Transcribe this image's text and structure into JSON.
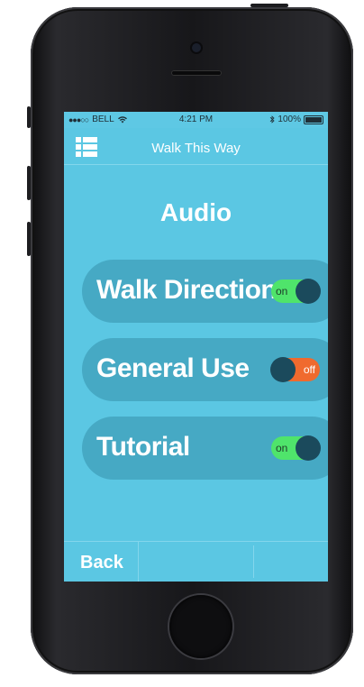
{
  "status_bar": {
    "signal": "●●●○○",
    "carrier": "BELL",
    "wifi_icon": "wifi-icon",
    "time": "4:21 PM",
    "bluetooth_icon": "bluetooth-icon",
    "battery": "100%"
  },
  "nav": {
    "title": "Walk This Way",
    "menu_icon": "list-menu-icon"
  },
  "page": {
    "title": "Audio"
  },
  "settings": [
    {
      "label": "Walk Direction",
      "state": "on",
      "state_label": "on"
    },
    {
      "label": "General Use",
      "state": "off",
      "state_label": "off"
    },
    {
      "label": "Tutorial",
      "state": "on",
      "state_label": "on"
    }
  ],
  "footer": {
    "back_label": "Back"
  },
  "colors": {
    "screen_bg": "#5bc7e3",
    "row_bg": "#46a9c4",
    "toggle_on": "#4fe46b",
    "toggle_off": "#f06a2e",
    "knob": "#1b4a5c"
  }
}
